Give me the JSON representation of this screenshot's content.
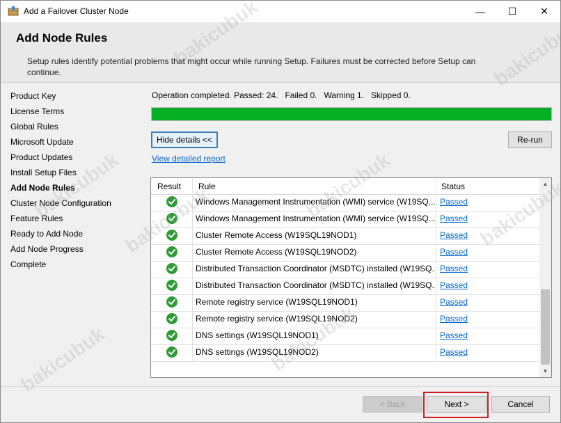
{
  "window": {
    "title": "Add a Failover Cluster Node",
    "controls": {
      "minimize": "—",
      "maximize": "☐",
      "close": "✕"
    }
  },
  "header": {
    "title": "Add Node Rules",
    "description": "Setup rules identify potential problems that might occur while running Setup. Failures must be corrected before Setup can continue."
  },
  "nav": {
    "items": [
      {
        "label": "Product Key",
        "active": false
      },
      {
        "label": "License Terms",
        "active": false
      },
      {
        "label": "Global Rules",
        "active": false
      },
      {
        "label": "Microsoft Update",
        "active": false
      },
      {
        "label": "Product Updates",
        "active": false
      },
      {
        "label": "Install Setup Files",
        "active": false
      },
      {
        "label": "Add Node Rules",
        "active": true
      },
      {
        "label": "Cluster Node Configuration",
        "active": false
      },
      {
        "label": "Feature Rules",
        "active": false
      },
      {
        "label": "Ready to Add Node",
        "active": false
      },
      {
        "label": "Add Node Progress",
        "active": false
      },
      {
        "label": "Complete",
        "active": false
      }
    ]
  },
  "main": {
    "status": "Operation completed. Passed: 24.   Failed 0.   Warning 1.   Skipped 0.",
    "progress": 1.0,
    "hide_details_label": "Hide details <<",
    "rerun_label": "Re-run",
    "report_link": "View detailed report",
    "columns": {
      "result": "Result",
      "rule": "Rule",
      "status": "Status"
    },
    "rows": [
      {
        "rule": "Windows Management Instrumentation (WMI) service (W19SQ...",
        "status": "Passed"
      },
      {
        "rule": "Windows Management Instrumentation (WMI) service (W19SQ...",
        "status": "Passed"
      },
      {
        "rule": "Cluster Remote Access (W19SQL19NOD1)",
        "status": "Passed"
      },
      {
        "rule": "Cluster Remote Access (W19SQL19NOD2)",
        "status": "Passed"
      },
      {
        "rule": "Distributed Transaction Coordinator (MSDTC) installed (W19SQ...",
        "status": "Passed"
      },
      {
        "rule": "Distributed Transaction Coordinator (MSDTC) installed (W19SQ...",
        "status": "Passed"
      },
      {
        "rule": "Remote registry service (W19SQL19NOD1)",
        "status": "Passed"
      },
      {
        "rule": "Remote registry service (W19SQL19NOD2)",
        "status": "Passed"
      },
      {
        "rule": "DNS settings (W19SQL19NOD1)",
        "status": "Passed"
      },
      {
        "rule": "DNS settings (W19SQL19NOD2)",
        "status": "Passed"
      }
    ]
  },
  "footer": {
    "back_label": "< Back",
    "next_label": "Next >",
    "cancel_label": "Cancel"
  },
  "watermark": "bakicubuk",
  "colors": {
    "progress": "#06b025",
    "link": "#0066cc",
    "highlight": "#d8181e"
  }
}
